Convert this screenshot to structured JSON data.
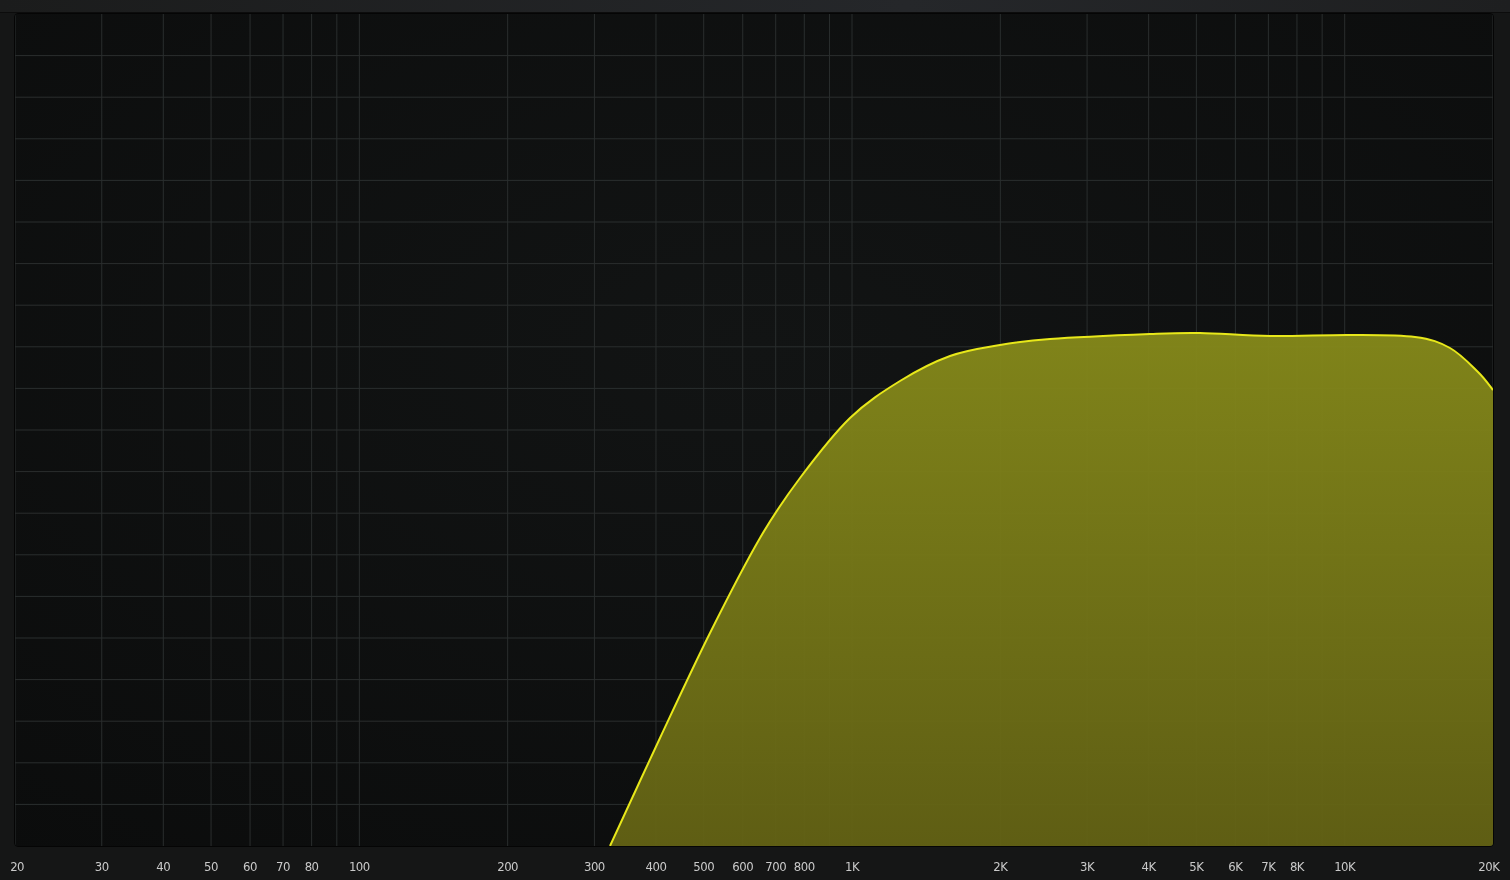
{
  "x_axis": {
    "labels": [
      "20",
      "30",
      "40",
      "50",
      "60",
      "70",
      "80",
      "100",
      "200",
      "300",
      "400",
      "500",
      "600",
      "700",
      "800",
      "1K",
      "2K",
      "3K",
      "4K",
      "5K",
      "6K",
      "7K",
      "8K",
      "10K",
      "20K"
    ]
  }
}
